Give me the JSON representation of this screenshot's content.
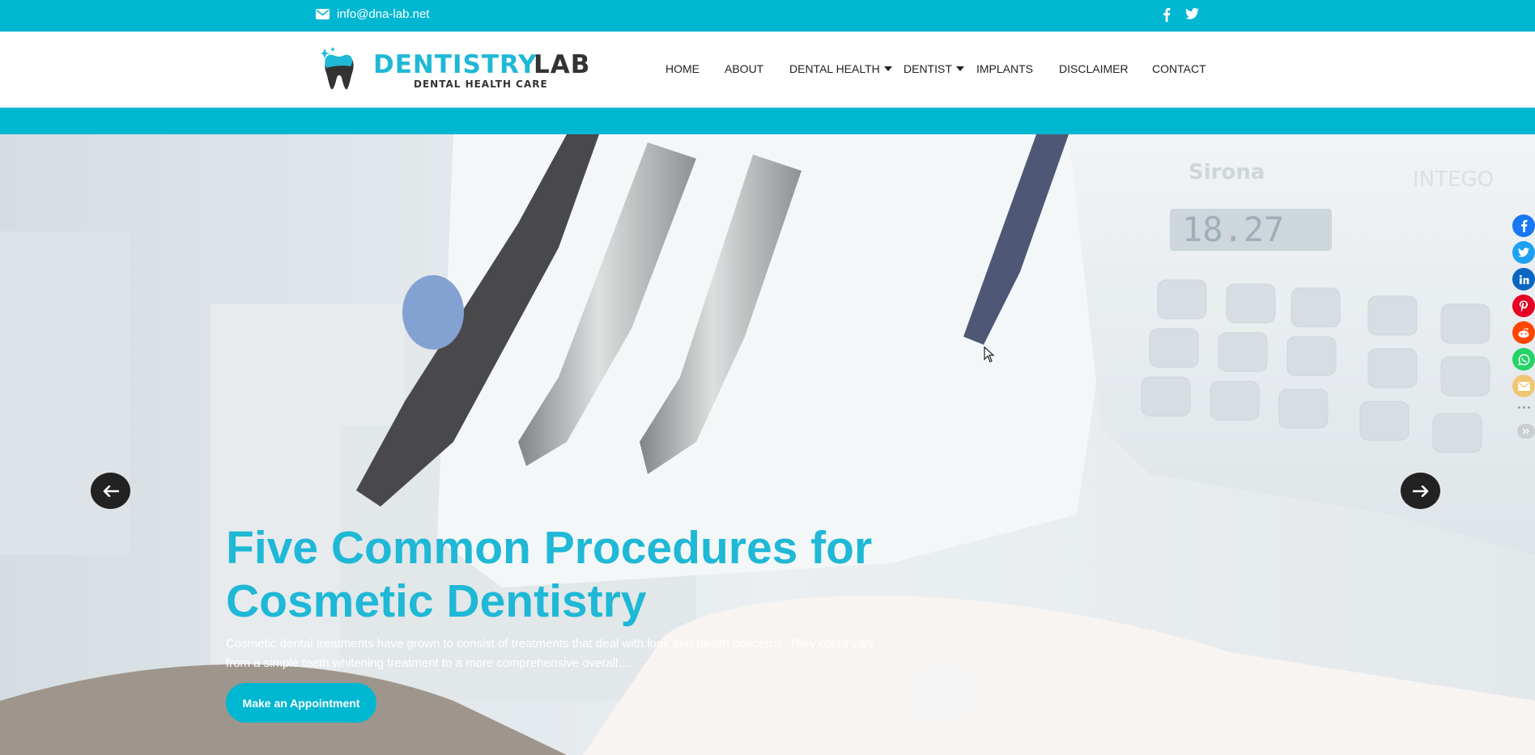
{
  "topbar": {
    "email": "info@dna-lab.net",
    "social_icons": [
      "facebook-icon",
      "twitter-icon"
    ]
  },
  "logo": {
    "word1": "DENTISTRY",
    "word2": "LAB",
    "tagline": "DENTAL HEALTH CARE"
  },
  "nav": {
    "items": [
      {
        "label": "HOME"
      },
      {
        "label": "ABOUT"
      },
      {
        "label": "DENTAL HEALTH"
      },
      {
        "label": "DENTIST"
      },
      {
        "label": "IMPLANTS"
      },
      {
        "label": "DISCLAIMER"
      },
      {
        "label": "CONTACT"
      }
    ]
  },
  "hero": {
    "headline": "Five Common Procedures for Cosmetic Dentistry",
    "subtext": "Cosmetic dental treatments have grown to consist of treatments that deal with look and health concerns. They could vary from a simple teeth whitening treatment to a more comprehensive overall…",
    "cta_label": "Make an Appointment",
    "display_reading": "18.27",
    "brand_text": "Sirona",
    "model_text": "INTEGO"
  },
  "share_bar": {
    "icons": [
      "facebook-icon",
      "twitter-icon",
      "linkedin-icon",
      "pinterest-icon",
      "reddit-icon",
      "whatsapp-icon",
      "email-icon"
    ],
    "colors": [
      "#1877f2",
      "#1da1f2",
      "#0a66c2",
      "#e60023",
      "#ff4500",
      "#25d366",
      "#f0c674"
    ]
  },
  "colors": {
    "accent": "#00b7d2",
    "headline": "#1fb8d6",
    "dark": "#222222"
  }
}
